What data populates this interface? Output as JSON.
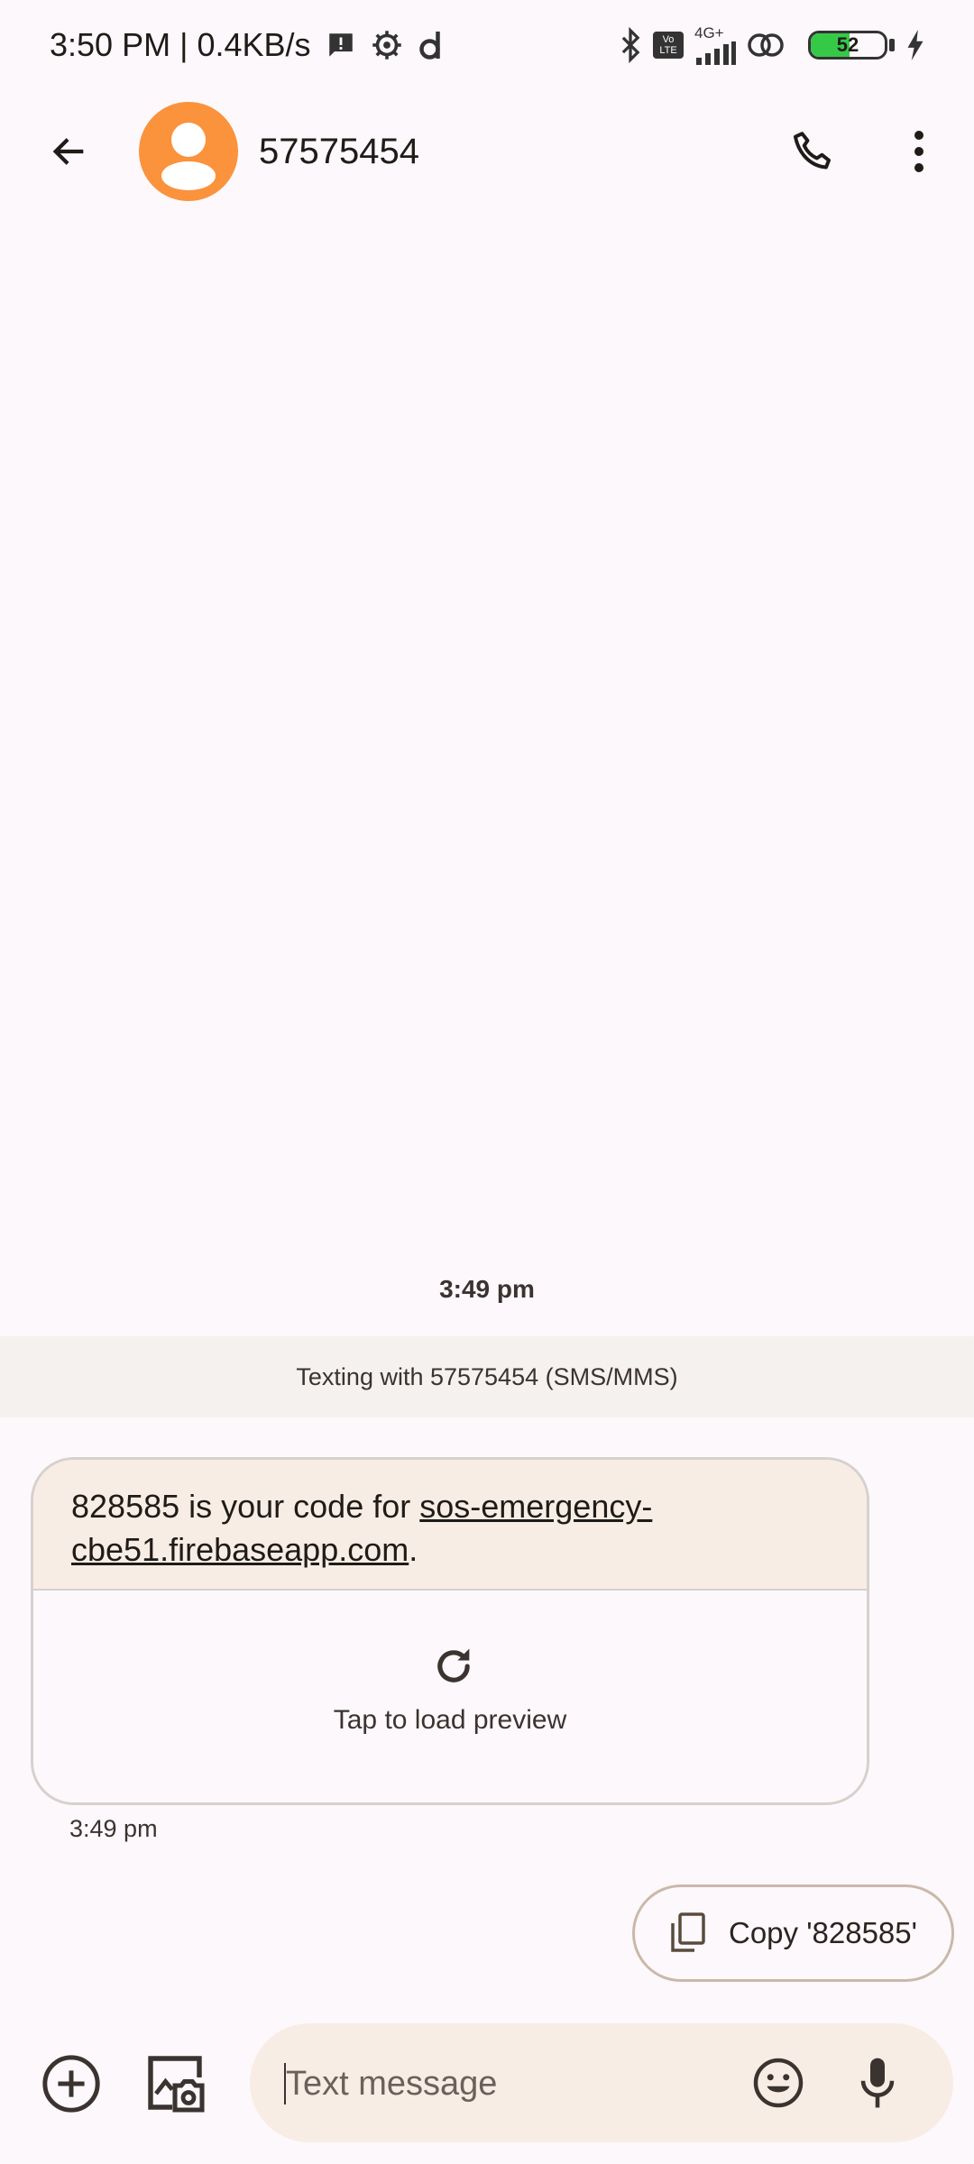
{
  "status_bar": {
    "time": "3:50 PM",
    "separator": "|",
    "net_speed": "0.4KB/s",
    "network_type": "4G+",
    "volte_label": "Vo LTE",
    "battery_percent": 52,
    "battery_text": "52",
    "icons": [
      "message-alert-icon",
      "settings-gear-icon",
      "d-app-icon",
      "bluetooth-icon",
      "volte-icon",
      "signal-icon",
      "link-icon",
      "battery-icon",
      "charging-icon"
    ]
  },
  "header": {
    "contact_name": "57575454",
    "avatar_color": "#fb923c"
  },
  "conversation": {
    "top_timestamp": "3:49 pm",
    "texting_banner": "Texting with 57575454 (SMS/MMS)",
    "message": {
      "prefix": "828585 is your code for ",
      "link": "sos-emergency-cbe51.firebaseapp.com",
      "suffix": ".",
      "preview_label": "Tap to load preview",
      "time": "3:49 pm"
    },
    "suggestion": {
      "label": "Copy '828585'"
    }
  },
  "compose": {
    "placeholder": "Text message"
  },
  "colors": {
    "background": "#fdf8fb",
    "bubble_fill": "#f8ede4",
    "banner": "#f5f1ef",
    "accent": "#fb923c"
  }
}
